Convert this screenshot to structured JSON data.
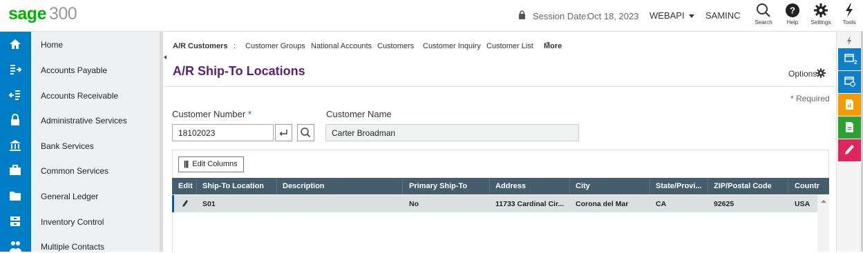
{
  "app": {
    "brand": "sage",
    "version": "300"
  },
  "session": {
    "label": "Session Date:",
    "date": "Oct 18, 2023",
    "user": "WEBAPI",
    "company": "SAMINC"
  },
  "top_tools": [
    {
      "label": "Search",
      "icon": "search-icon"
    },
    {
      "label": "Help",
      "icon": "help-icon"
    },
    {
      "label": "Settings",
      "icon": "gear-icon"
    },
    {
      "label": "Tools",
      "icon": "lightning-icon"
    }
  ],
  "sidebar": {
    "items": [
      {
        "label": "Home",
        "icon": "home-icon"
      },
      {
        "label": "Accounts Payable",
        "icon": "accounts-payable-icon"
      },
      {
        "label": "Accounts Receivable",
        "icon": "accounts-receivable-icon"
      },
      {
        "label": "Administrative Services",
        "icon": "lock-icon"
      },
      {
        "label": "Bank Services",
        "icon": "bank-icon"
      },
      {
        "label": "Common Services",
        "icon": "briefcase-icon"
      },
      {
        "label": "General Ledger",
        "icon": "folder-icon"
      },
      {
        "label": "Inventory Control",
        "icon": "inventory-icon"
      },
      {
        "label": "Multiple Contacts",
        "icon": "contacts-icon"
      }
    ]
  },
  "breadcrumb": {
    "root": "A/R Customers",
    "separator": ":",
    "links": [
      "Customer Groups",
      "National Accounts",
      "Customers",
      "Customer Inquiry",
      "Customer List"
    ],
    "more": "More"
  },
  "page": {
    "title": "A/R Ship-To Locations",
    "options_label": "Options",
    "required_note": "* Required"
  },
  "form": {
    "customer_number_label": "Customer Number",
    "required_star": "*",
    "customer_number_value": "18102023",
    "customer_name_label": "Customer Name",
    "customer_name_value": "Carter Broadman"
  },
  "grid": {
    "edit_columns_label": "Edit Columns",
    "columns": [
      "Edit",
      "Ship-To Location",
      "Description",
      "Primary Ship-To",
      "Address",
      "City",
      "State/Provi...",
      "ZIP/Postal Code",
      "Countr"
    ],
    "rows": [
      {
        "ship_to": "S01",
        "description": "",
        "primary": "No",
        "address": "11733 Cardinal Cir...",
        "city": "Corona del Mar",
        "state": "CA",
        "zip": "92625",
        "country": "USA"
      }
    ]
  },
  "right_rail": {
    "badge_count": "2",
    "colors": [
      "#0f7fc7",
      "#0f7fc7",
      "#f79a00",
      "#2aa332",
      "#e0245e"
    ]
  },
  "colors": {
    "brand_green": "#00b300",
    "nav_blue": "#007ec5",
    "title_purple": "#5a1f6e",
    "grid_header": "#445e6e"
  }
}
